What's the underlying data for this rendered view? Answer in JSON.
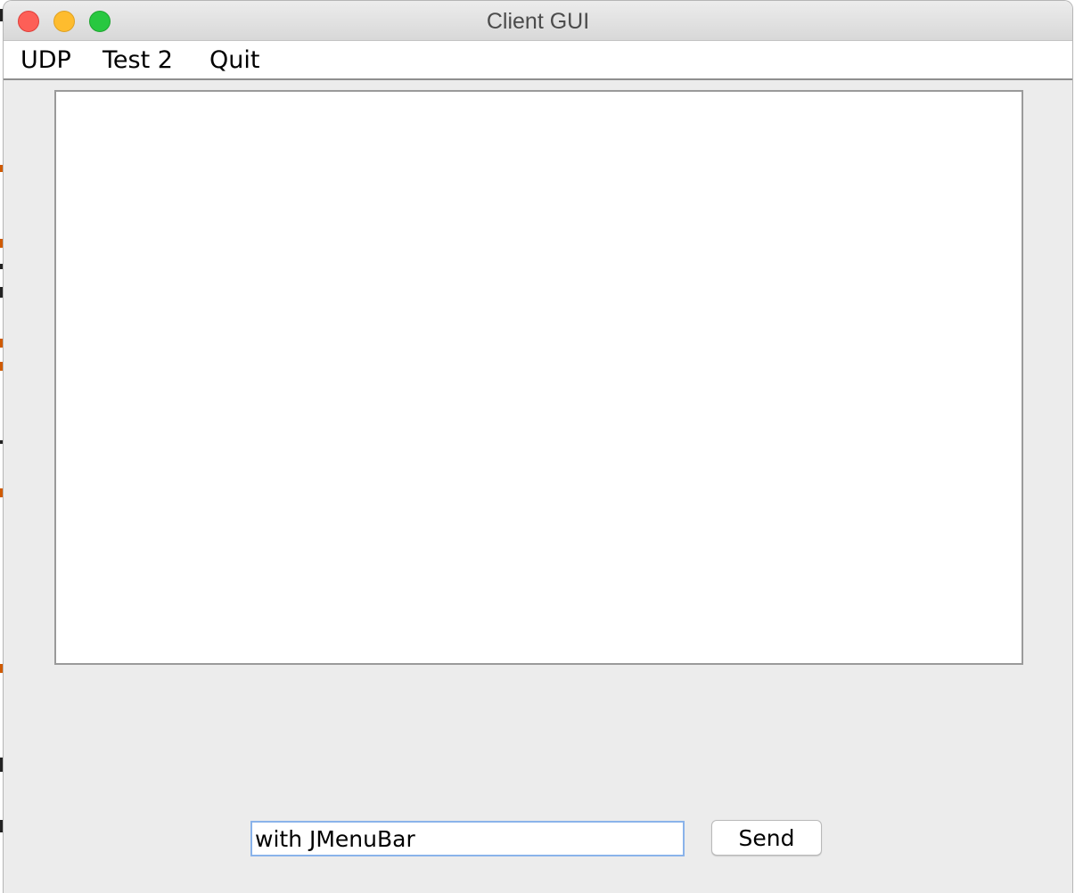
{
  "window": {
    "title": "Client GUI",
    "buttons": [
      "close",
      "minimize",
      "zoom"
    ]
  },
  "menubar": {
    "items": [
      {
        "label": "UDP"
      },
      {
        "label": "Test 2"
      },
      {
        "label": "Quit"
      }
    ]
  },
  "output": {
    "text": ""
  },
  "input": {
    "value": "with JMenuBar"
  },
  "send": {
    "label": "Send"
  },
  "colors": {
    "close": "#fd5f57",
    "minimize": "#febc2e",
    "zoom": "#28c840",
    "input_focus_border": "#8ab3ea",
    "window_background": "#ececec"
  }
}
